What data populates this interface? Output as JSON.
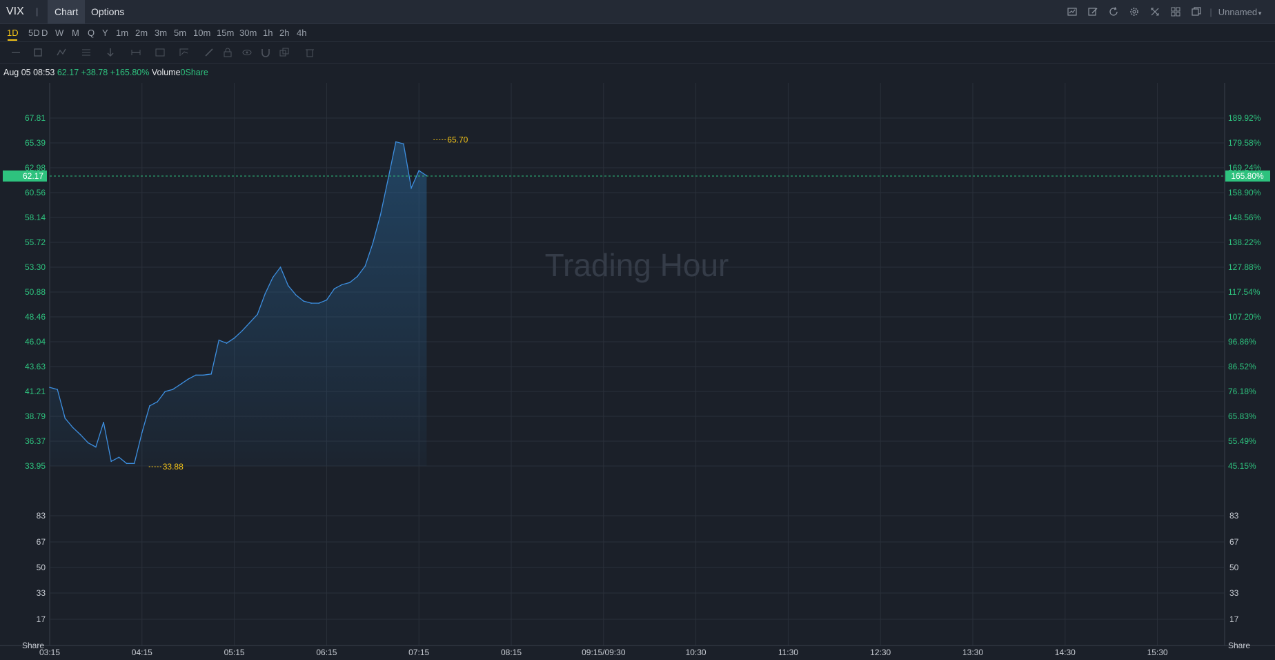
{
  "header": {
    "symbol": "VIX",
    "separator": "|",
    "tabs": [
      {
        "label": "Chart",
        "active": true
      },
      {
        "label": "Options",
        "active": false
      }
    ],
    "toolbar_icons": [
      "chart-type-icon",
      "draw-icon",
      "refresh-icon",
      "settings-icon",
      "fullscreen-icon",
      "layout-grid-icon",
      "window-icon"
    ],
    "layout_name": "Unnamed"
  },
  "intervals": [
    "1D",
    "5D",
    "D",
    "W",
    "M",
    "Q",
    "Y",
    "1m",
    "2m",
    "3m",
    "5m",
    "10m",
    "15m",
    "30m",
    "1h",
    "2h",
    "4h"
  ],
  "active_interval": "1D",
  "drawing_tools": [
    "line-tool-icon",
    "shape-tool-icon",
    "pattern-tool-icon",
    "fib-tool-icon",
    "arrow-tool-icon",
    "measure-tool-icon",
    "text-tool-icon",
    "indicator-tool-icon",
    "pen-icon",
    "lock-icon",
    "eye-icon",
    "magnet-icon",
    "clone-icon",
    "trash-icon"
  ],
  "infobar": {
    "datetime": "Aug 05 08:53",
    "price": "62.17",
    "change": "+38.78",
    "change_pct": "+165.80%",
    "volume_label": "Volume",
    "volume_value": "0Share"
  },
  "colors": {
    "background": "#1b2029",
    "grid": "#2a303a",
    "line": "#3d8fe0",
    "up": "#2ec27e",
    "highlight": "#f5c518",
    "watermark": "#353c48"
  },
  "chart_data": {
    "type": "area",
    "watermark": "Trading Hour",
    "ylim": [
      33.95,
      67.81
    ],
    "y_ticks": [
      "67.81",
      "65.39",
      "62.98",
      "60.56",
      "58.14",
      "55.72",
      "53.30",
      "50.88",
      "48.46",
      "46.04",
      "43.63",
      "41.21",
      "38.79",
      "36.37",
      "33.95"
    ],
    "y_ticks_right": [
      "189.92%",
      "179.58%",
      "169.24%",
      "158.90%",
      "148.56%",
      "138.22%",
      "127.88%",
      "117.54%",
      "107.20%",
      "96.86%",
      "86.52%",
      "76.18%",
      "65.83%",
      "55.49%",
      "45.15%"
    ],
    "x_ticks": [
      "03:15",
      "04:15",
      "05:15",
      "06:15",
      "07:15",
      "08:15",
      "09:15/09:30",
      "10:30",
      "11:30",
      "12:30",
      "13:30",
      "14:30",
      "15:30"
    ],
    "x_minutes": [
      0,
      5,
      10,
      15,
      20,
      25,
      30,
      35,
      40,
      45,
      50,
      55,
      60,
      65,
      70,
      75,
      80,
      85,
      90,
      95,
      100,
      105,
      110,
      115,
      120,
      125,
      130,
      135,
      140,
      145,
      150,
      155,
      160,
      165,
      170,
      175,
      180,
      185,
      190,
      195,
      200,
      205,
      210,
      215,
      220,
      225,
      230,
      235,
      240,
      245,
      250,
      255,
      258,
      260,
      262,
      265,
      268,
      270,
      275,
      278
    ],
    "y": [
      41.6,
      41.4,
      38.6,
      37.7,
      37.0,
      36.2,
      35.8,
      38.2,
      34.4,
      34.8,
      34.2,
      34.2,
      37.2,
      39.8,
      40.2,
      41.2,
      41.4,
      41.9,
      42.4,
      42.8,
      42.8,
      42.9,
      46.2,
      45.9,
      46.4,
      47.1,
      47.9,
      48.7,
      50.7,
      52.3,
      53.3,
      51.5,
      50.6,
      50.0,
      49.8,
      49.8,
      50.1,
      51.2,
      51.6,
      51.8,
      52.4,
      53.4,
      55.6,
      58.4,
      61.9,
      65.5,
      65.3,
      61.0,
      62.7,
      62.2
    ],
    "high": {
      "value": "65.70",
      "minute": 249
    },
    "low": {
      "value": "33.88",
      "minute": 64
    },
    "last_price": {
      "left": "62.17",
      "right": "165.80%"
    },
    "volume_axis": {
      "ticks": [
        "83",
        "67",
        "50",
        "33",
        "17"
      ],
      "unit": "Share"
    }
  }
}
